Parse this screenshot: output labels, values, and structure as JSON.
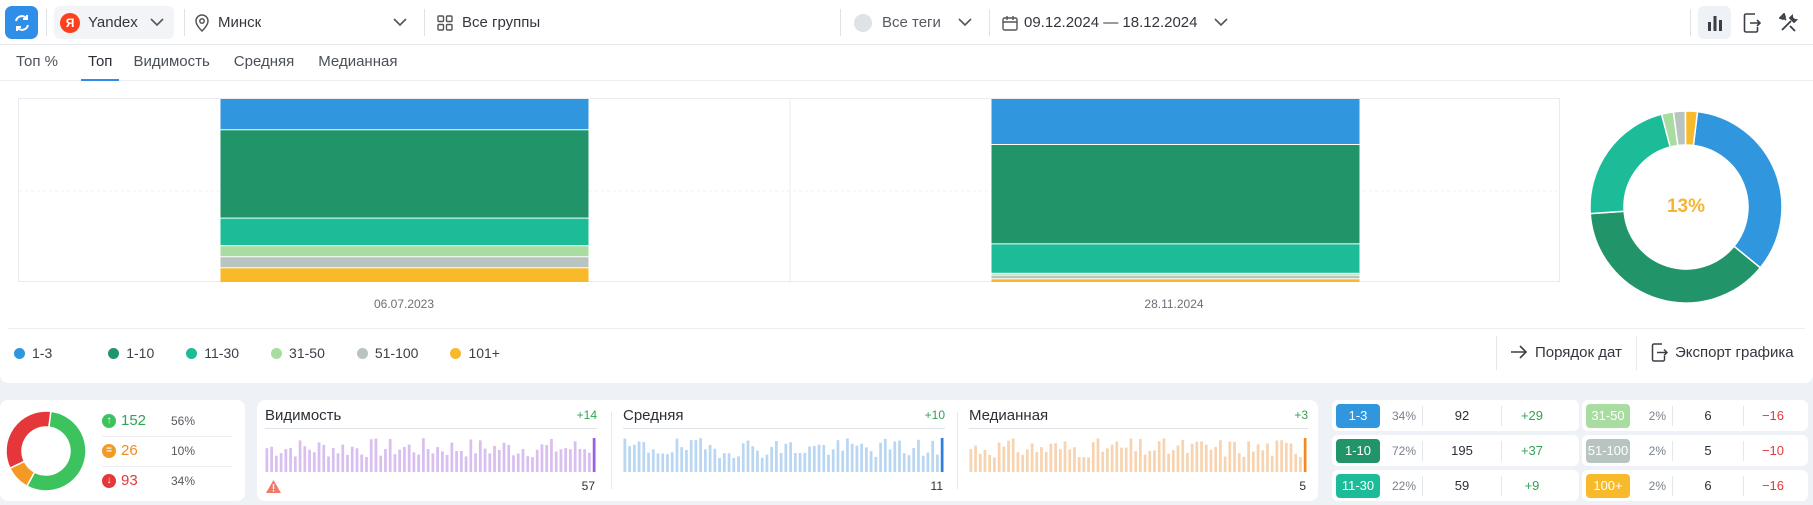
{
  "toolbar": {
    "engine": "Yandex",
    "engine_logo": "Я",
    "region": "Минск",
    "groups": "Все группы",
    "tags": "Все теги",
    "date_range": "09.12.2024 — 18.12.2024"
  },
  "tabs": [
    {
      "label": "Топ %",
      "active": false
    },
    {
      "label": "Топ",
      "active": true
    },
    {
      "label": "Видимость",
      "active": false
    },
    {
      "label": "Средняя",
      "active": false
    },
    {
      "label": "Медианная",
      "active": false
    }
  ],
  "chart_data": [
    {
      "type": "bar",
      "stacked": true,
      "categories": [
        "06.07.2023",
        "28.11.2024"
      ],
      "series": [
        {
          "name": "1-3",
          "color": "#3096de",
          "values": [
            17,
            25
          ]
        },
        {
          "name": "1-10",
          "color": "#22946a",
          "values": [
            48,
            54
          ]
        },
        {
          "name": "11-30",
          "color": "#1cbc98",
          "values": [
            15,
            16
          ]
        },
        {
          "name": "31-50",
          "color": "#a8dca0",
          "values": [
            6,
            1
          ]
        },
        {
          "name": "51-100",
          "color": "#b8c4c0",
          "values": [
            6,
            2
          ]
        },
        {
          "name": "101+",
          "color": "#f8b92a",
          "values": [
            8,
            2
          ]
        }
      ]
    },
    {
      "type": "pie",
      "donut": true,
      "center_label": "13%",
      "series": [
        {
          "name": "1-3",
          "color": "#3096de",
          "value": 34
        },
        {
          "name": "1-10",
          "color": "#22946a",
          "value": 38
        },
        {
          "name": "11-30",
          "color": "#1cbc98",
          "value": 22
        },
        {
          "name": "31-50",
          "color": "#a8dca0",
          "value": 2
        },
        {
          "name": "51-100",
          "color": "#b8c4c0",
          "value": 2
        },
        {
          "name": "101+",
          "color": "#f8b92a",
          "value": 2
        }
      ]
    }
  ],
  "legend": [
    {
      "label": "1-3",
      "color": "#3096de"
    },
    {
      "label": "1-10",
      "color": "#22946a"
    },
    {
      "label": "11-30",
      "color": "#1cbc98"
    },
    {
      "label": "31-50",
      "color": "#a8dca0"
    },
    {
      "label": "51-100",
      "color": "#b8c4c0"
    },
    {
      "label": "101+",
      "color": "#f8b92a"
    }
  ],
  "actions": {
    "date_order": "Порядок дат",
    "export": "Экспорт графика"
  },
  "trend": {
    "up": {
      "count": "152",
      "pct": "56%"
    },
    "same": {
      "count": "26",
      "pct": "10%"
    },
    "down": {
      "count": "93",
      "pct": "34%"
    },
    "colors": {
      "up": "#3cc35d",
      "same": "#f39a24",
      "down": "#e5373a"
    }
  },
  "metrics": [
    {
      "title": "Видимость",
      "delta": "+14",
      "value": "57",
      "color": "#d9bff0",
      "accent": "#9b5ee0"
    },
    {
      "title": "Средняя",
      "delta": "+10",
      "value": "11",
      "color": "#b9d6f2",
      "accent": "#2f7fe0"
    },
    {
      "title": "Медианная",
      "delta": "+3",
      "value": "5",
      "color": "#f7d3b0",
      "accent": "#f08a24"
    }
  ],
  "ranges": [
    {
      "label": "1-3",
      "pct": "34%",
      "count": "92",
      "delta": "+29",
      "color": "#3096de",
      "sign": "pos"
    },
    {
      "label": "1-10",
      "pct": "72%",
      "count": "195",
      "delta": "+37",
      "color": "#22946a",
      "sign": "pos"
    },
    {
      "label": "11-30",
      "pct": "22%",
      "count": "59",
      "delta": "+9",
      "color": "#1cbc98",
      "sign": "pos"
    },
    {
      "label": "31-50",
      "pct": "2%",
      "count": "6",
      "delta": "−16",
      "color": "#a8dca0",
      "sign": "neg"
    },
    {
      "label": "51-100",
      "pct": "2%",
      "count": "5",
      "delta": "−10",
      "color": "#b8c4c0",
      "sign": "neg"
    },
    {
      "label": "100+",
      "pct": "2%",
      "count": "6",
      "delta": "−16",
      "color": "#f8b92a",
      "sign": "neg"
    }
  ]
}
